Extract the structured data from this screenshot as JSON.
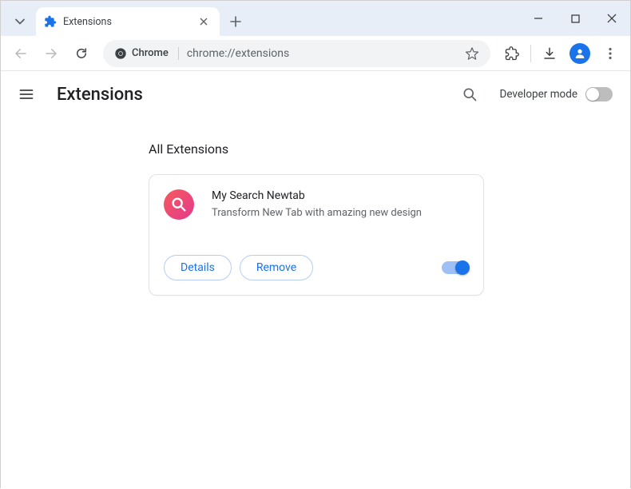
{
  "browser": {
    "tab_title": "Extensions",
    "url": "chrome://extensions",
    "omnibox_chip": "Chrome"
  },
  "page": {
    "title": "Extensions",
    "developer_mode_label": "Developer mode",
    "section_title": "All Extensions"
  },
  "extension": {
    "name": "My Search Newtab",
    "description": "Transform New Tab with amazing new design",
    "details_label": "Details",
    "remove_label": "Remove",
    "enabled": true
  }
}
